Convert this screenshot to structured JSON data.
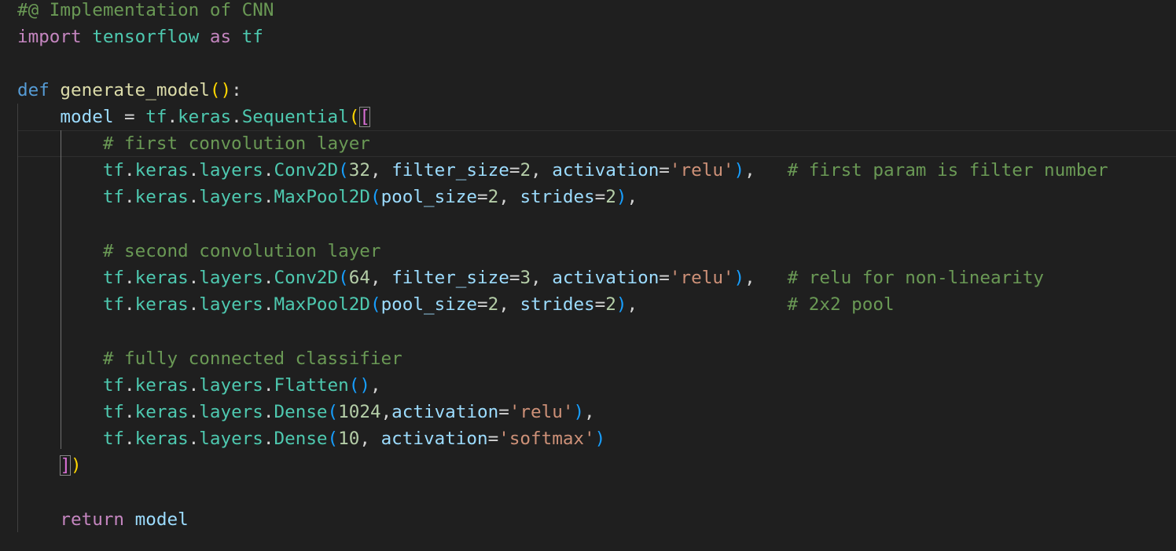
{
  "editor": {
    "language": "python",
    "theme": "dark",
    "lines": {
      "l1": {
        "comment": "#@ Implementation of CNN"
      },
      "l2": {
        "kw": "import",
        "module": "tensorflow",
        "as_kw": "as",
        "alias": "tf"
      },
      "l4": {
        "kw": "def",
        "fn": "generate_model",
        "open": "(",
        "close": ")",
        "colon": ":"
      },
      "l5": {
        "var": "model",
        "eq": " = ",
        "tf": "tf",
        "dot1": ".",
        "keras": "keras",
        "dot2": ".",
        "cls": "Sequential",
        "paren": "(",
        "bracket": "["
      },
      "l6": {
        "comment": "# first convolution layer"
      },
      "l7": {
        "tf": "tf",
        "dot1": ".",
        "keras": "keras",
        "dot2": ".",
        "layers": "layers",
        "dot3": ".",
        "cls": "Conv2D",
        "open": "(",
        "num1": "32",
        "sep1": ", ",
        "p1": "filter_size",
        "eq1": "=",
        "v1": "2",
        "sep2": ", ",
        "p2": "activation",
        "eq2": "=",
        "s2": "'relu'",
        "close": ")",
        "tail": ",   ",
        "comment": "# first param is filter number"
      },
      "l8": {
        "tf": "tf",
        "dot1": ".",
        "keras": "keras",
        "dot2": ".",
        "layers": "layers",
        "dot3": ".",
        "cls": "MaxPool2D",
        "open": "(",
        "p1": "pool_size",
        "eq1": "=",
        "v1": "2",
        "sep1": ", ",
        "p2": "strides",
        "eq2": "=",
        "v2": "2",
        "close": ")",
        "tail": ","
      },
      "l10": {
        "comment": "# second convolution layer"
      },
      "l11": {
        "tf": "tf",
        "dot1": ".",
        "keras": "keras",
        "dot2": ".",
        "layers": "layers",
        "dot3": ".",
        "cls": "Conv2D",
        "open": "(",
        "num1": "64",
        "sep1": ", ",
        "p1": "filter_size",
        "eq1": "=",
        "v1": "3",
        "sep2": ", ",
        "p2": "activation",
        "eq2": "=",
        "s2": "'relu'",
        "close": ")",
        "tail": ",   ",
        "comment": "# relu for non-linearity"
      },
      "l12": {
        "tf": "tf",
        "dot1": ".",
        "keras": "keras",
        "dot2": ".",
        "layers": "layers",
        "dot3": ".",
        "cls": "MaxPool2D",
        "open": "(",
        "p1": "pool_size",
        "eq1": "=",
        "v1": "2",
        "sep1": ", ",
        "p2": "strides",
        "eq2": "=",
        "v2": "2",
        "close": ")",
        "tail": ",              ",
        "comment": "# 2x2 pool"
      },
      "l14": {
        "comment": "# fully connected classifier"
      },
      "l15": {
        "tf": "tf",
        "dot1": ".",
        "keras": "keras",
        "dot2": ".",
        "layers": "layers",
        "dot3": ".",
        "cls": "Flatten",
        "open": "(",
        "close": ")",
        "tail": ","
      },
      "l16": {
        "tf": "tf",
        "dot1": ".",
        "keras": "keras",
        "dot2": ".",
        "layers": "layers",
        "dot3": ".",
        "cls": "Dense",
        "open": "(",
        "num1": "1024",
        "sep1": ",",
        "p1": "activation",
        "eq1": "=",
        "s1": "'relu'",
        "close": ")",
        "tail": ","
      },
      "l17": {
        "tf": "tf",
        "dot1": ".",
        "keras": "keras",
        "dot2": ".",
        "layers": "layers",
        "dot3": ".",
        "cls": "Dense",
        "open": "(",
        "num1": "10",
        "sep1": ", ",
        "p1": "activation",
        "eq1": "=",
        "s1": "'softmax'",
        "close": ")"
      },
      "l18": {
        "bracket": "]",
        "paren": ")"
      },
      "l20": {
        "kw": "return",
        "var": "model"
      }
    }
  },
  "colors": {
    "background": "#1f1f1f",
    "comment": "#6a9955",
    "keyword_control": "#c586c0",
    "keyword_def": "#569cd6",
    "module_class": "#4ec9b0",
    "function": "#dcdcaa",
    "variable": "#9cdcfe",
    "string": "#ce9178",
    "number": "#b5cea8",
    "bracket_level1": "#ffd700",
    "bracket_level2": "#da70d6",
    "bracket_level3": "#179fff"
  }
}
